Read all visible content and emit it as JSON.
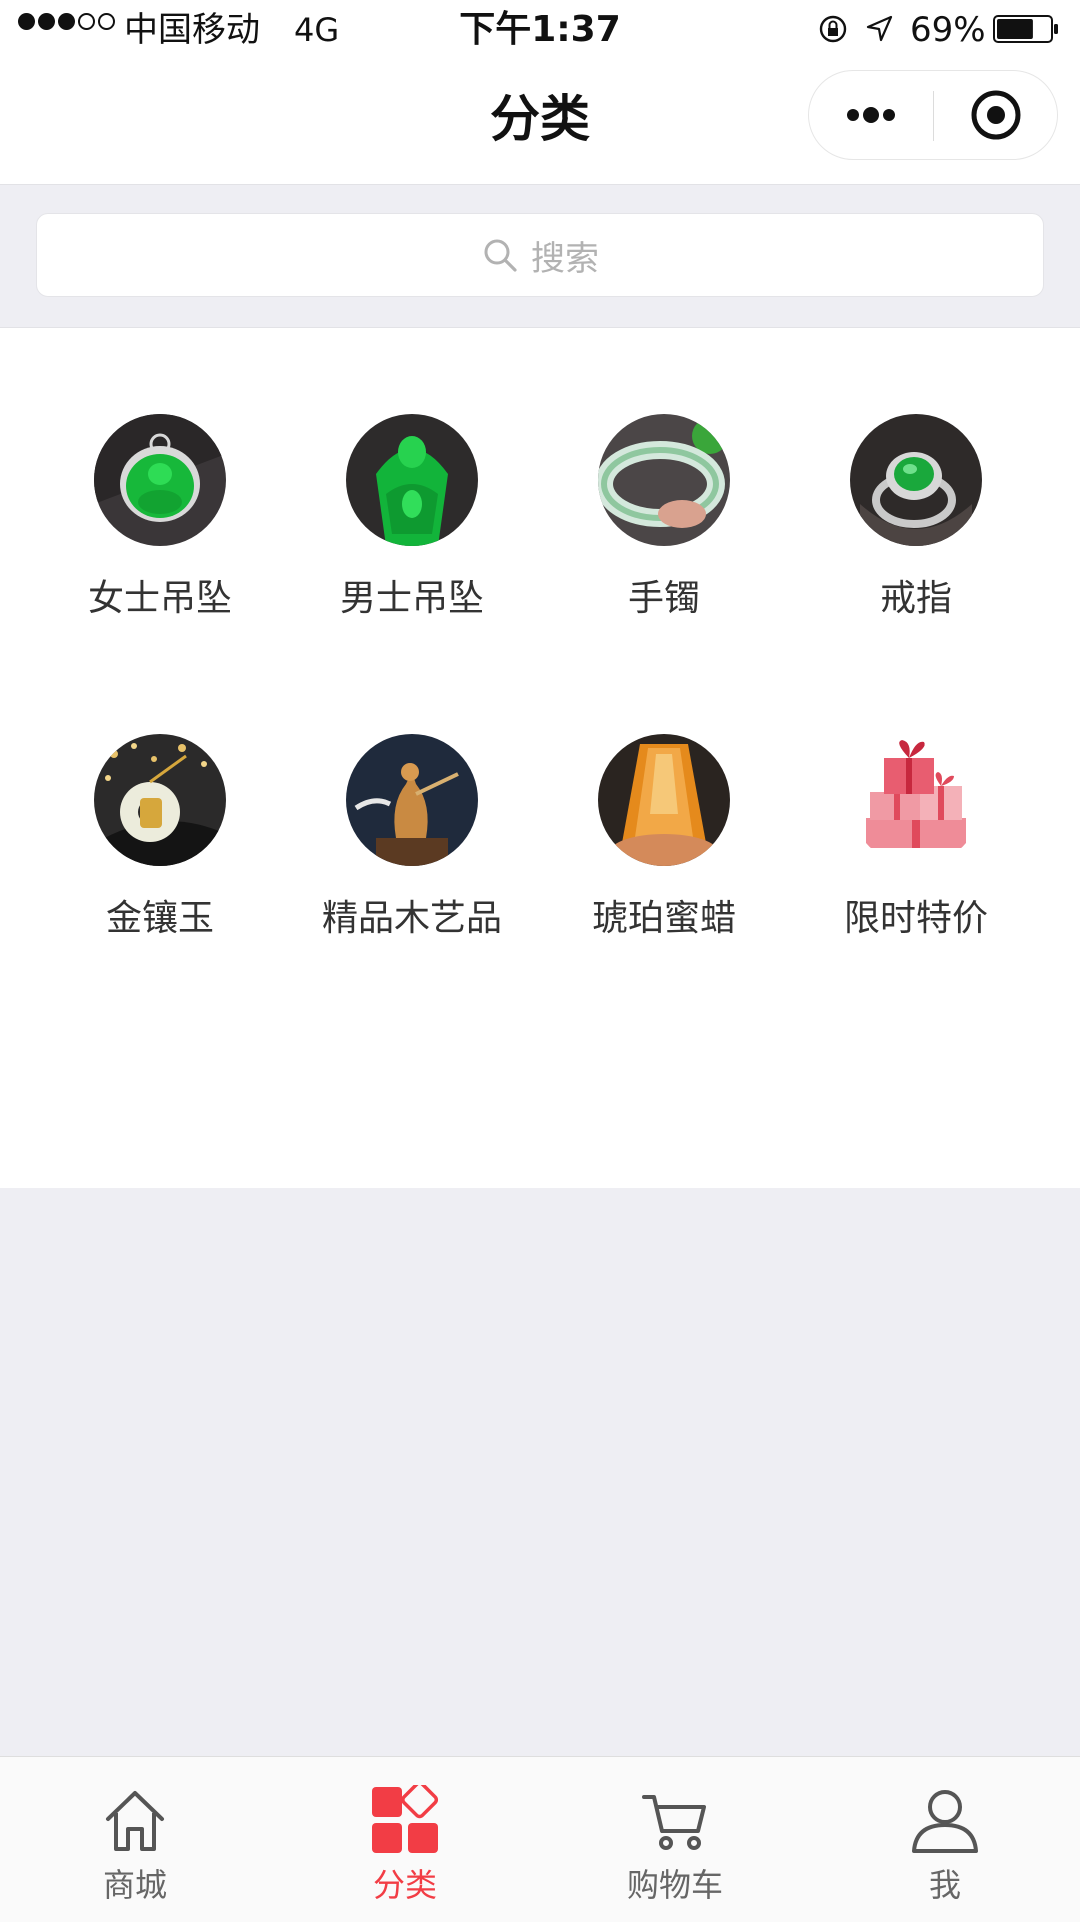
{
  "status_bar": {
    "carrier": "中国移动",
    "network": "4G",
    "time": "下午1:37",
    "battery_percent": "69%",
    "battery_level": 0.69,
    "signal_bars": 3,
    "signal_total": 5
  },
  "nav": {
    "title": "分类",
    "more_icon": "more-dots-icon",
    "close_icon": "target-close-icon"
  },
  "search": {
    "placeholder": "搜索",
    "icon": "search-icon"
  },
  "categories": [
    {
      "label": "女士吊坠",
      "icon": "jade-pendant-female"
    },
    {
      "label": "男士吊坠",
      "icon": "jade-buddha-pendant"
    },
    {
      "label": "手镯",
      "icon": "jade-bangle"
    },
    {
      "label": "戒指",
      "icon": "jade-ring"
    },
    {
      "label": "金镶玉",
      "icon": "gold-inlaid-jade"
    },
    {
      "label": "精品木艺品",
      "icon": "wood-carving"
    },
    {
      "label": "琥珀蜜蜡",
      "icon": "amber-beeswax"
    },
    {
      "label": "限时特价",
      "icon": "gift-boxes"
    }
  ],
  "tab_bar": {
    "items": [
      {
        "label": "商城",
        "icon": "home-icon",
        "active": false
      },
      {
        "label": "分类",
        "icon": "category-icon",
        "active": true
      },
      {
        "label": "购物车",
        "icon": "cart-icon",
        "active": false
      },
      {
        "label": "我",
        "icon": "user-icon",
        "active": false
      }
    ]
  },
  "colors": {
    "accent": "#f23d45",
    "page_background": "#eeeef3",
    "tab_inactive": "#666666"
  }
}
